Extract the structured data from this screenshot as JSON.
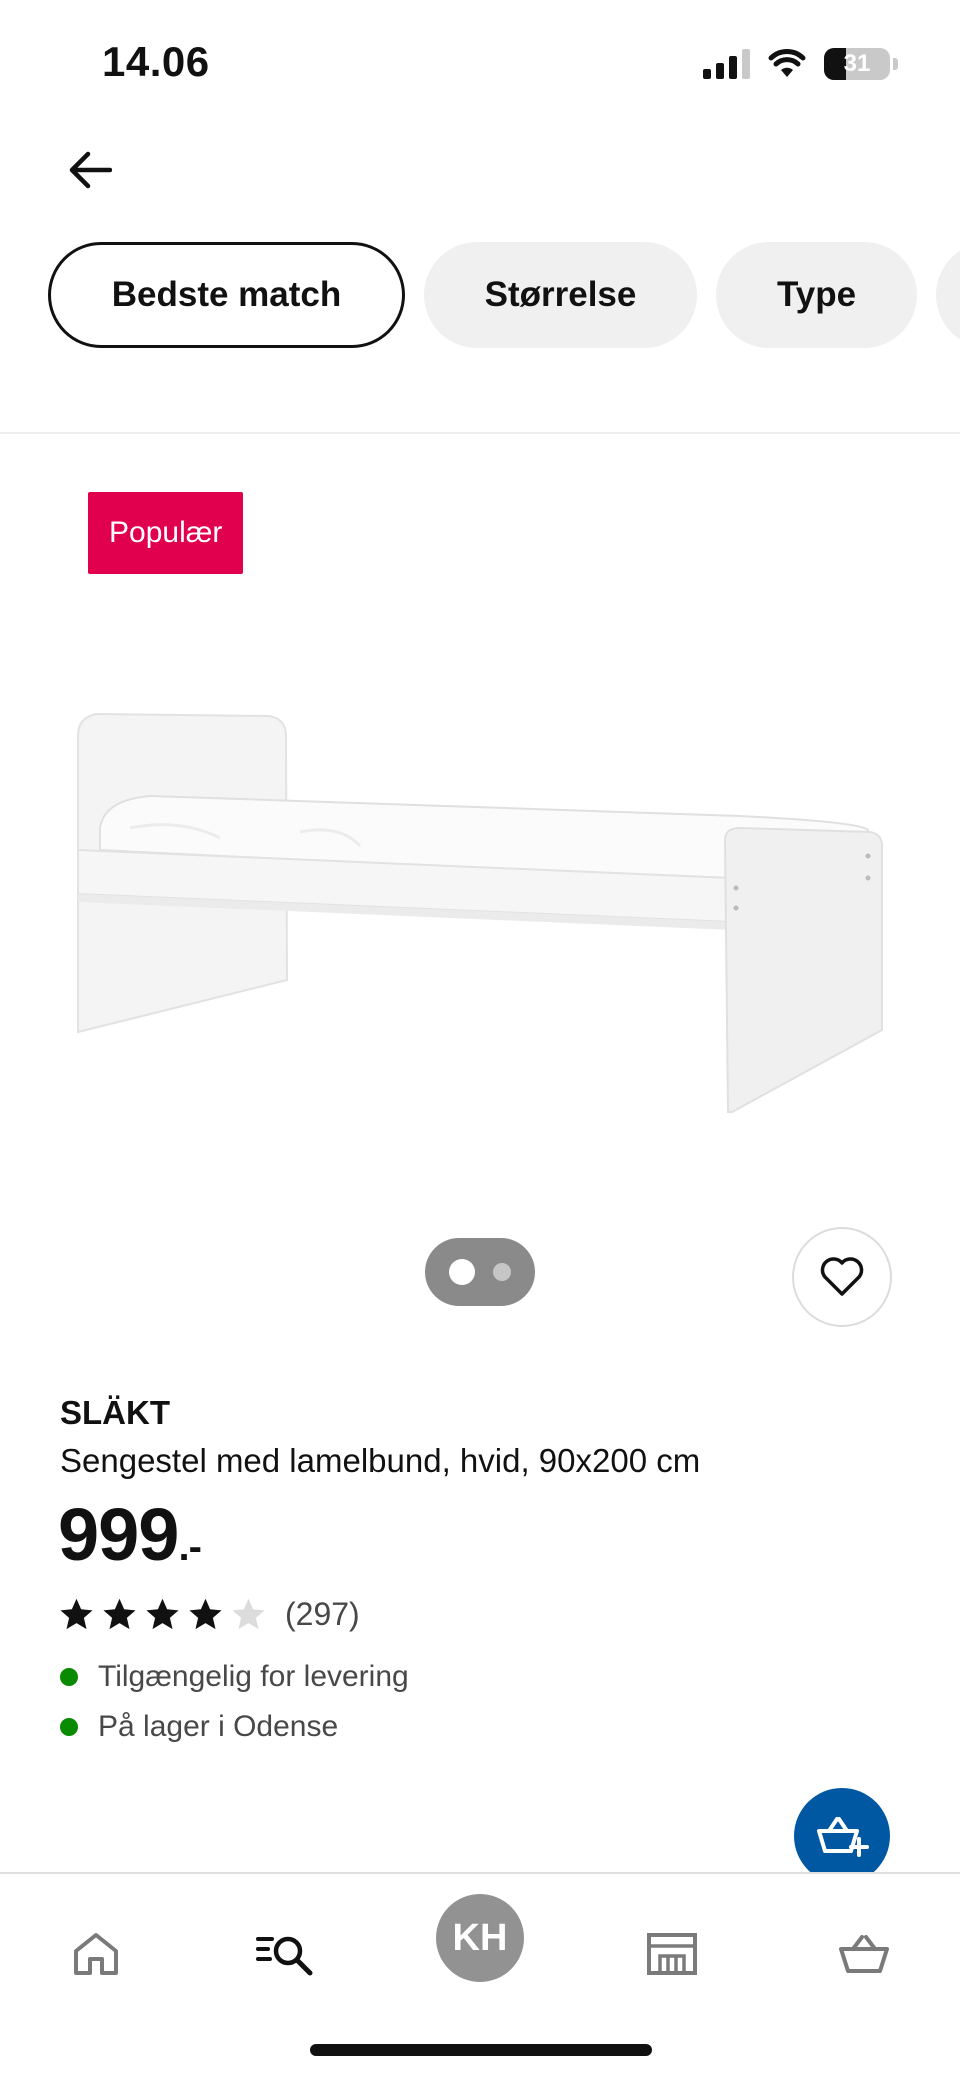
{
  "status_bar": {
    "time": "14.06",
    "battery": "31"
  },
  "filters": [
    {
      "label": "Bedste match",
      "active": true
    },
    {
      "label": "Størrelse",
      "active": false
    },
    {
      "label": "Type",
      "active": false
    }
  ],
  "product": {
    "badge": "Populær",
    "name": "SLÄKT",
    "description": "Sengestel med lamelbund, hvid, 90x200 cm",
    "price": "999",
    "price_suffix": ".-",
    "rating": 4,
    "rating_max": 5,
    "review_count": "(297)",
    "image_count": 2,
    "availability": [
      {
        "text": "Tilgængelig for levering",
        "status_color": "#0a8a00"
      },
      {
        "text": "På lager i Odense",
        "status_color": "#0a8a00"
      }
    ]
  },
  "bottom_nav": {
    "items": [
      "home-icon",
      "search-icon",
      "profile-avatar",
      "store-icon",
      "basket-icon"
    ],
    "avatar_initials": "KH"
  },
  "colors": {
    "badge": "#e0004d",
    "primary_blue": "#0058a3",
    "in_stock": "#0a8a00"
  }
}
